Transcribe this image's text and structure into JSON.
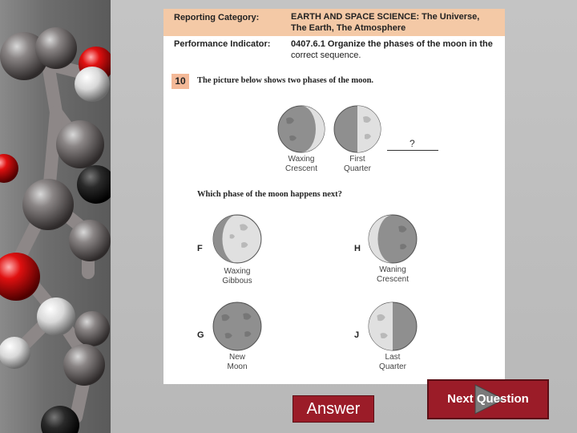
{
  "header": {
    "reporting_category_label": "Reporting Category:",
    "reporting_category_value_line1": "EARTH AND SPACE SCIENCE: The Universe,",
    "reporting_category_value_line2": "The Earth, The Atmosphere",
    "performance_indicator_label": "Performance Indicator:",
    "performance_indicator_value_line1": "0407.6.1 Organize the phases of the moon in the",
    "performance_indicator_value_line2": "correct sequence."
  },
  "question": {
    "number": "10",
    "prompt": "The picture below shows two phases of the moon.",
    "sequence": [
      {
        "line1": "Waxing",
        "line2": "Crescent"
      },
      {
        "line1": "First",
        "line2": "Quarter"
      }
    ],
    "unknown_mark": "?",
    "followup": "Which phase of the moon happens next?",
    "choices": [
      {
        "letter": "F",
        "line1": "Waxing",
        "line2": "Gibbous"
      },
      {
        "letter": "H",
        "line1": "Waning",
        "line2": "Crescent"
      },
      {
        "letter": "G",
        "line1": "New",
        "line2": "Moon"
      },
      {
        "letter": "J",
        "line1": "Last",
        "line2": "Quarter"
      }
    ]
  },
  "buttons": {
    "answer_label": "Answer",
    "next_label": "Next Question"
  },
  "colors": {
    "header_band": "#f4c9a6",
    "number_badge": "#f4b998",
    "button_fill": "#9b1c28",
    "moon_dark": "#8f8f8f",
    "moon_light": "#e0e0e0"
  }
}
